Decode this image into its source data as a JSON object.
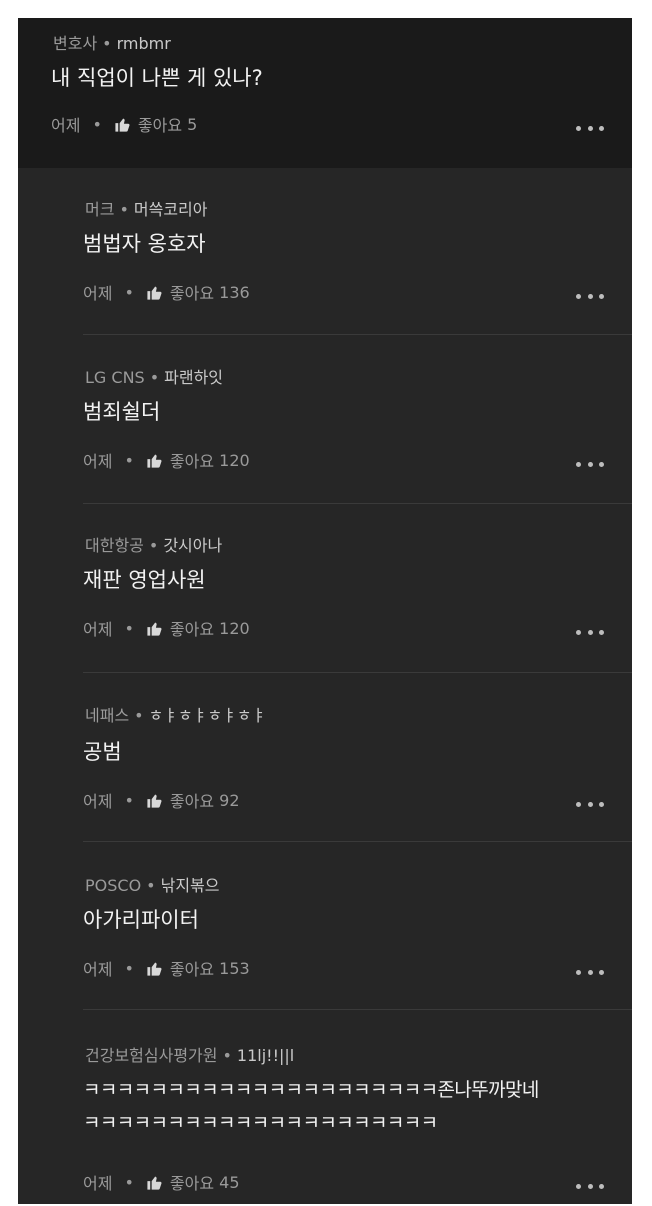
{
  "comments": [
    {
      "company": "변호사",
      "nickname": "rmbmr",
      "text": "내 직업이 나쁜 게 있나?",
      "time": "어제",
      "like_label": "좋아요",
      "likes": "5"
    },
    {
      "company": "머크",
      "nickname": "머쓱코리아",
      "text": "범법자 옹호자",
      "time": "어제",
      "like_label": "좋아요",
      "likes": "136"
    },
    {
      "company": "LG CNS",
      "nickname": "파랜하잇",
      "text": "범죄쉴더",
      "time": "어제",
      "like_label": "좋아요",
      "likes": "120"
    },
    {
      "company": "대한항공",
      "nickname": "갓시아나",
      "text": "재판 영업사원",
      "time": "어제",
      "like_label": "좋아요",
      "likes": "120"
    },
    {
      "company": "네패스",
      "nickname": "ㅎㅑㅎㅑㅎㅑㅎㅑ",
      "text": "공범",
      "time": "어제",
      "like_label": "좋아요",
      "likes": "92"
    },
    {
      "company": "POSCO",
      "nickname": "낚지볶으",
      "text": "아가리파이터",
      "time": "어제",
      "like_label": "좋아요",
      "likes": "153"
    },
    {
      "company": "건강보험심사평가원",
      "nickname": "11lj!!||l",
      "text": "ㅋㅋㅋㅋㅋㅋㅋㅋㅋㅋㅋㅋㅋㅋㅋㅋㅋㅋㅋㅋㅋ존나뚜까맞네",
      "text2": "ㅋㅋㅋㅋㅋㅋㅋㅋㅋㅋㅋㅋㅋㅋㅋㅋㅋㅋㅋㅋㅋ",
      "time": "어제",
      "like_label": "좋아요",
      "likes": "45"
    }
  ],
  "separator": "•",
  "colors": {
    "panel": "#262626",
    "main_comment_bg": "#1a1a1a",
    "text": "#f2f2f2",
    "muted": "#9a9a9a"
  }
}
